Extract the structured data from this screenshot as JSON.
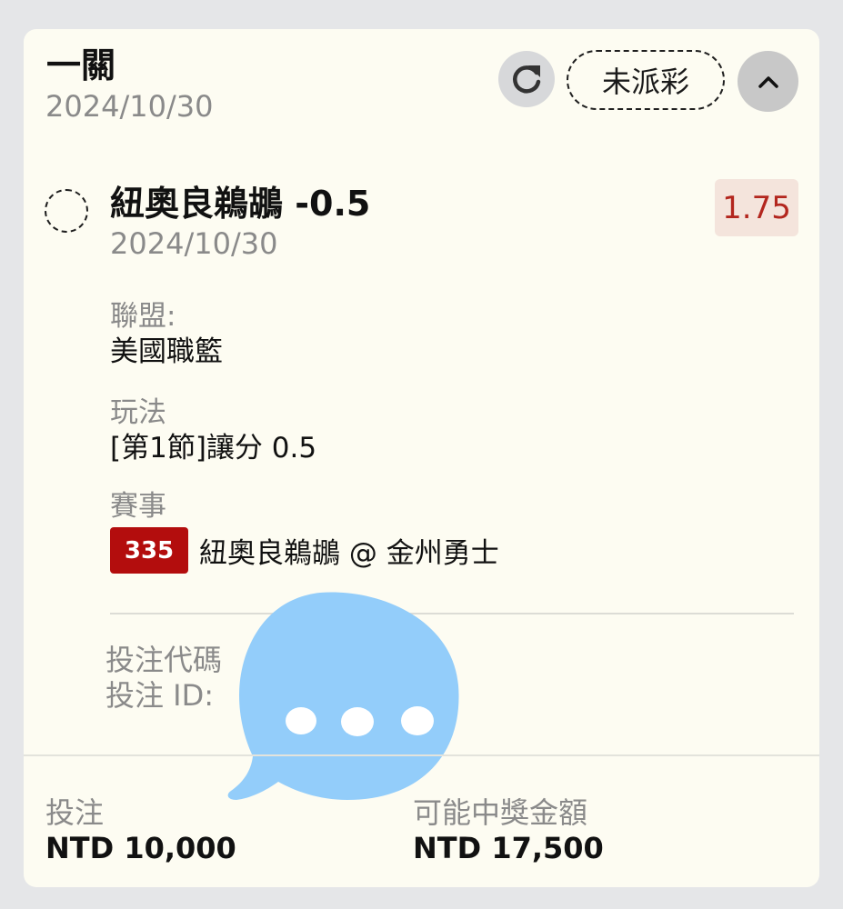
{
  "header": {
    "title": "一關",
    "date": "2024/10/30",
    "status": "未派彩",
    "icons": {
      "refresh": "refresh-icon",
      "collapse": "chevron-up-icon"
    }
  },
  "selection": {
    "title": "紐奧良鵜鶘 -0.5",
    "date": "2024/10/30",
    "odds": "1.75",
    "league_label": "聯盟:",
    "league_value": "美國職籃",
    "market_label": "玩法",
    "market_value": "[第1節]讓分 0.5",
    "event_label": "賽事",
    "event_code": "335",
    "event_name": "紐奧良鵜鶘 @ 金州勇士"
  },
  "bet_info": {
    "code_label": "投注代碼",
    "id_label": "投注 ID:"
  },
  "footer": {
    "stake_label": "投注",
    "stake_value": "NTD 10,000",
    "win_label": "可能中獎金額",
    "win_value": "NTD 17,500"
  },
  "colors": {
    "card_bg": "#fdfcf2",
    "odds_text": "#b3261e",
    "odds_bg": "#f4e4dc",
    "event_badge_bg": "#b30d0d",
    "overlay_bubble": "#93cdfa"
  }
}
